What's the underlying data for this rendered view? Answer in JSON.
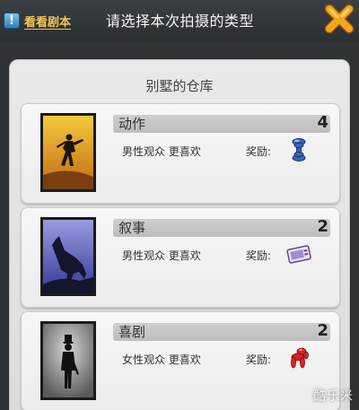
{
  "header": {
    "script_button_label": "看看剧本",
    "script_icon_glyph": "!",
    "title": "请选择本次拍摄的类型"
  },
  "panel": {
    "title": "别墅的仓库"
  },
  "cards": [
    {
      "type": "动作",
      "count": "4",
      "audience": "男性观众 更喜欢",
      "reward_label": "奖励:",
      "reward_icon": "dumbbell-icon",
      "thumb_colors": [
        "#f4c23c",
        "#c7761c"
      ]
    },
    {
      "type": "叙事",
      "count": "2",
      "audience": "男性观众 更喜欢",
      "reward_label": "奖励:",
      "reward_icon": "card-reader-icon",
      "thumb_colors": [
        "#8e90d8",
        "#3b3e94"
      ]
    },
    {
      "type": "喜剧",
      "count": "2",
      "audience": "女性观众 更喜欢",
      "reward_label": "奖励:",
      "reward_icon": "balloon-dog-icon",
      "thumb_colors": [
        "#b8b8b8",
        "#5e5e5e"
      ]
    }
  ],
  "watermark": "酷乐米",
  "colors": {
    "accent_gold": "#f1c65a",
    "close_orange": "#f3a51c"
  }
}
